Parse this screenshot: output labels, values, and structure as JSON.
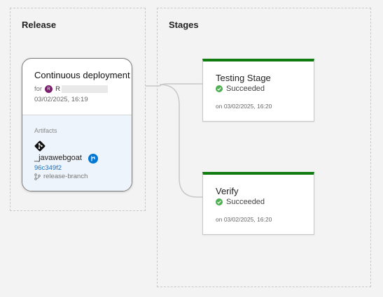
{
  "release_section": {
    "title": "Release"
  },
  "stages_section": {
    "title": "Stages"
  },
  "release_card": {
    "title": "Continuous deployment",
    "for_label": "for",
    "user_initials": "R",
    "user_name": "R",
    "date": "03/02/2025, 16:19",
    "artifacts_label": "Artifacts",
    "artifact_name": "_javawebgoat",
    "commit": "96c349f2",
    "branch": "release-branch"
  },
  "stages": [
    {
      "name": "Testing Stage",
      "status": "Succeeded",
      "date": "on 03/02/2025, 16:20"
    },
    {
      "name": "Verify",
      "status": "Succeeded",
      "date": "on 03/02/2025, 16:20"
    }
  ],
  "colors": {
    "success": "#107c10",
    "success_icon": "#4caf50",
    "link": "#1a6fbf",
    "ci_badge": "#0078d4",
    "avatar": "#7a1f6b"
  },
  "icons": {
    "artifact": "git-icon",
    "ci": "build-pipeline-icon",
    "branch": "branch-icon",
    "status": "check-circle-icon"
  }
}
